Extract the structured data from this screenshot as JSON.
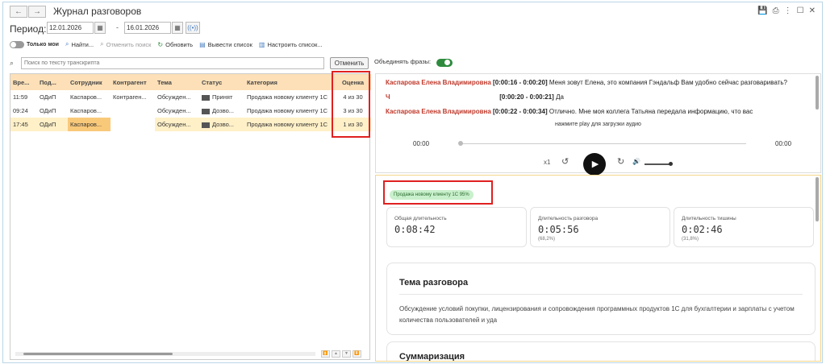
{
  "window": {
    "title": "Журнал разговоров",
    "back_icon": "←",
    "forward_icon": "→",
    "tools": [
      "💾",
      "⎙",
      "⋮",
      "☐",
      "✕"
    ]
  },
  "period": {
    "label": "Период:",
    "from": "12.01.2026",
    "to": "16.01.2026",
    "separator": "-",
    "calendar_icon": "▦",
    "radio_icon": "((•))"
  },
  "toolbar": {
    "only_mine": "Только мои",
    "find": "Найти...",
    "cancel_search": "Отменить поиск",
    "refresh": "Обновить",
    "export_list": "Вывести список",
    "configure_list": "Настроить список..."
  },
  "search": {
    "icon": "⌕",
    "placeholder": "Поиск по тексту транскрипта",
    "cancel": "Отменить",
    "merge_phrases": "Объединять фразы:"
  },
  "table": {
    "columns": [
      "Время",
      "Подразделение",
      "Сотрудник",
      "Контрагент",
      "Тема",
      "Статус",
      "Категория",
      "Оценка"
    ],
    "column_labels": [
      "Вре...",
      "Под...",
      "Сотрудник",
      "Контрагент",
      "Тема",
      "Статус",
      "Категория",
      "Оценка"
    ],
    "rows": [
      {
        "time": "11:59",
        "dept": "ОДиП",
        "employee": "Каспаров...",
        "counterparty": "Контраген...",
        "topic": "Обсужден...",
        "status": "Принят",
        "category": "Продажа новому клиенту 1С",
        "score": "4 из 30"
      },
      {
        "time": "09:24",
        "dept": "ОДиП",
        "employee": "Каспаров...",
        "counterparty": "",
        "topic": "Обсужден...",
        "status": "Дозво...",
        "category": "Продажа новому клиенту 1С",
        "score": "3 из 30"
      },
      {
        "time": "17:45",
        "dept": "ОДиП",
        "employee": "Каспаров...",
        "counterparty": "",
        "topic": "Обсужден...",
        "status": "Дозво...",
        "category": "Продажа новому клиенту 1С",
        "score": "1 из 30"
      }
    ],
    "selected_row": 2
  },
  "transcript": {
    "lines": [
      {
        "speaker": "Каспарова Елена Владимировна",
        "stamp": "[0:00:16 - 0:00:20]",
        "text": "Меня зовут Елена, это компания Гэндальф Вам удобно сейчас разговаривать?"
      },
      {
        "speaker": "Ч",
        "stamp": "[0:00:20 - 0:00:21]",
        "text": "Да"
      },
      {
        "speaker": "Каспарова Елена Владимировна",
        "stamp": "[0:00:22 - 0:00:34]",
        "text": "Отлично. Мне моя коллега Татьяна передала информацию, что вас"
      }
    ],
    "play_hint": "нажмите play для загрузки аудио",
    "time_start": "00:00",
    "time_end": "00:00",
    "speed": "x1",
    "rewind_icon": "↺",
    "forward_icon": "↻",
    "play_icon": "▶",
    "volume_icon": "🔊"
  },
  "analytics": {
    "category_badge": "Продажа новому клиенту 1С 95%",
    "stats": [
      {
        "label": "Общая длительность",
        "value": "0:08:42",
        "pct": ""
      },
      {
        "label": "Длительность разговора",
        "value": "0:05:56",
        "pct": "(68,2%)"
      },
      {
        "label": "Длительность тишины",
        "value": "0:02:46",
        "pct": "(31,8%)"
      }
    ],
    "topic_title": "Тема разговора",
    "topic_text": "Обсуждение условий покупки, лицензирования и сопровождения программных продуктов 1С для бухгалтерии и зарплаты с учетом количества пользователей и уда",
    "summary_title": "Суммаризация"
  },
  "colors": {
    "header_bg": "#fde0b8",
    "selected_row": "#fff0c8",
    "selected_cell": "#f9c97a",
    "highlight": "#e02020",
    "speaker": "#c0392b",
    "toggle_on": "#2e8b3e",
    "badge_bg": "#c9f0cc"
  }
}
